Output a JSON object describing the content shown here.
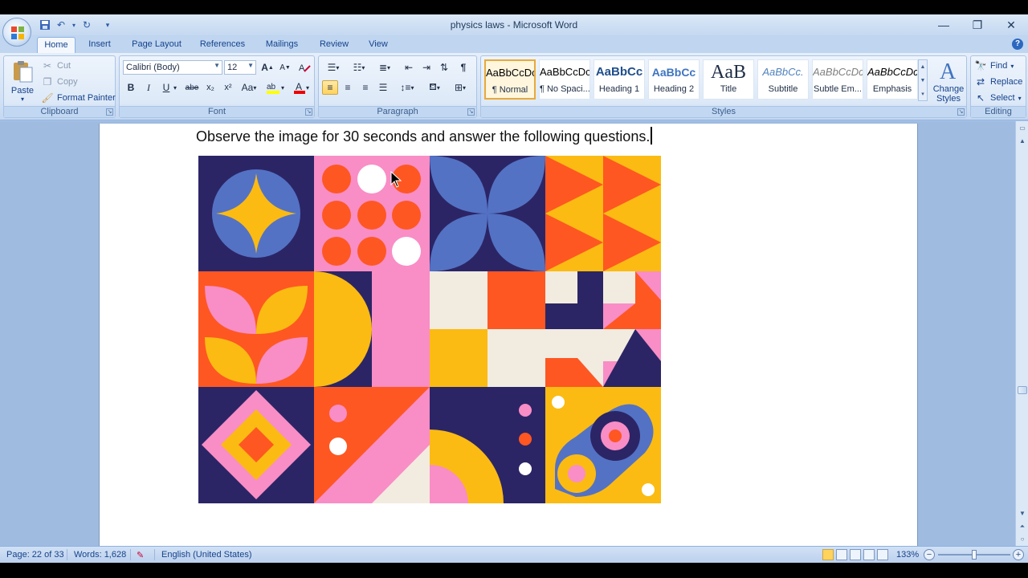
{
  "window": {
    "title": "physics laws - Microsoft Word",
    "controls": [
      "minimize",
      "restore",
      "close"
    ]
  },
  "quick_access": [
    "save-icon",
    "undo-icon",
    "redo-icon",
    "customize-icon"
  ],
  "tabs": [
    {
      "label": "Home",
      "active": true
    },
    {
      "label": "Insert"
    },
    {
      "label": "Page Layout"
    },
    {
      "label": "References"
    },
    {
      "label": "Mailings"
    },
    {
      "label": "Review"
    },
    {
      "label": "View"
    }
  ],
  "ribbon": {
    "clipboard": {
      "label": "Clipboard",
      "paste": "Paste",
      "cut": "Cut",
      "copy": "Copy",
      "format_painter": "Format Painter"
    },
    "font": {
      "label": "Font",
      "font_name": "Calibri (Body)",
      "font_size": "12",
      "bold": "B",
      "italic": "I",
      "underline": "U",
      "strike": "abe",
      "subscript": "x₂",
      "superscript": "x²",
      "change_case": "Aa",
      "grow": "A",
      "shrink": "A",
      "font_color_letter": "A"
    },
    "paragraph": {
      "label": "Paragraph",
      "pilcrow": "¶"
    },
    "styles": {
      "label": "Styles",
      "items": [
        {
          "preview": "AaBbCcDc",
          "name": "¶ Normal",
          "selected": true
        },
        {
          "preview": "AaBbCcDc",
          "name": "¶ No Spaci..."
        },
        {
          "preview": "AaBbCc",
          "name": "Heading 1"
        },
        {
          "preview": "AaBbCc",
          "name": "Heading 2"
        },
        {
          "preview": "AaB",
          "name": "Title"
        },
        {
          "preview": "AaBbCc.",
          "name": "Subtitle"
        },
        {
          "preview": "AaBbCcDc",
          "name": "Subtle Em..."
        },
        {
          "preview": "AaBbCcDc",
          "name": "Emphasis"
        }
      ],
      "change_styles": "Change Styles"
    },
    "editing": {
      "label": "Editing",
      "find": "Find",
      "replace": "Replace",
      "select": "Select"
    }
  },
  "document": {
    "text": "Observe the image for 30 seconds and answer the following questions."
  },
  "colors": {
    "navy": "#2b2566",
    "blue": "#5472c4",
    "yellow": "#fbbb12",
    "orange": "#fe5722",
    "pink": "#f98dc6",
    "cream": "#f2ebe0",
    "white": "#ffffff"
  },
  "statusbar": {
    "page": "Page: 22 of 33",
    "words": "Words: 1,628",
    "language": "English (United States)",
    "zoom": "133%",
    "zoom_fraction": 0.5
  }
}
